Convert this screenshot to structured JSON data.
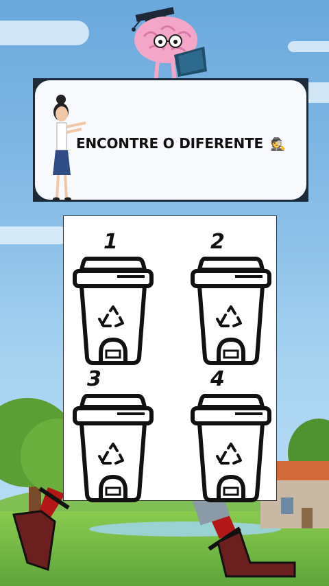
{
  "banner": {
    "title": "ENCONTRE O DIFERENTE",
    "emoji": "🕵️"
  },
  "puzzle": {
    "items": [
      {
        "number": "1",
        "icon": "trash-bin-recycle-icon"
      },
      {
        "number": "2",
        "icon": "trash-bin-recycle-icon"
      },
      {
        "number": "3",
        "icon": "trash-bin-recycle-icon"
      },
      {
        "number": "4",
        "icon": "trash-bin-recycle-icon"
      }
    ]
  },
  "colors": {
    "sky": "#8cc0e8",
    "grass": "#6db544",
    "brain": "#f3a6c8",
    "banner_bg": "#f7f9fc",
    "outline": "#111111"
  }
}
